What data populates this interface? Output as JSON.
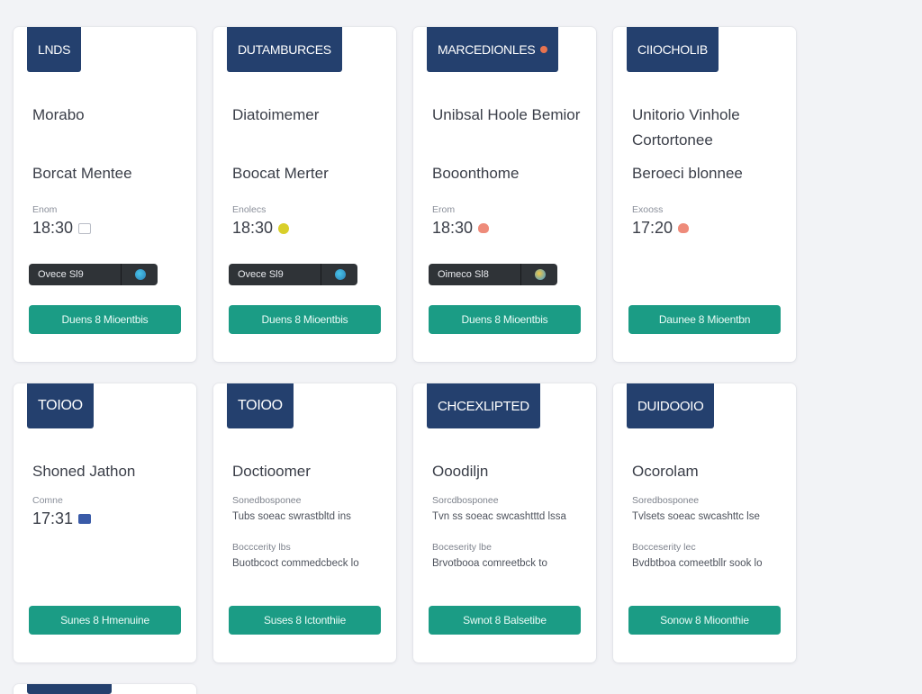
{
  "colors": {
    "tag_bg": "#24406e",
    "button_bg": "#1b9c85",
    "pill_bg": "#2f3337",
    "page_bg": "#f2f3f6"
  },
  "row1": [
    {
      "tag": "LNDS",
      "title": "Morabo",
      "subtitle": "Borcat Mentee",
      "mini": "Enom",
      "time": "18:30",
      "time_icon": "calendar-icon",
      "pill": "Ovece  Sl9",
      "button": "Duens 8  Mioentbis",
      "tag_icon": null
    },
    {
      "tag": "DUTAMBURCES",
      "title": "Diatoimemer",
      "subtitle": "Boocat Merter",
      "mini": "Enolecs",
      "time": "18:30",
      "time_icon": "smiley-icon",
      "pill": "Ovece  Sl9",
      "button": "Duens 8  Mioentbis",
      "tag_icon": null
    },
    {
      "tag": "MARCEDIONLES",
      "title": "Unibsal Hoole Bemior",
      "subtitle": "Booonthome",
      "mini": "Erom",
      "time": "18:30",
      "time_icon": "heart-icon",
      "pill": "Oimeco  Sl8",
      "button": "Duens 8  Mioentbis",
      "tag_icon": "dot-icon"
    },
    {
      "tag": "CIIOCHOLIB",
      "title": "Unitorio Vinhole Cortortonee",
      "subtitle": "Beroeci blonnee",
      "mini": "Exooss",
      "time": "17:20",
      "time_icon": "heart-icon",
      "pill": null,
      "button": "Daunee 8  Mioentbn",
      "tag_icon": null
    }
  ],
  "row2": [
    {
      "tag": "TOIOO",
      "title": "Shoned Jathon",
      "mini": "Comne",
      "time": "17:31",
      "time_icon": "badge-icon",
      "lines": [],
      "button": "Sunes 8  Hmenuine"
    },
    {
      "tag": "TOIOO",
      "title": "Doctioomer",
      "mini": null,
      "time": null,
      "time_icon": null,
      "lines": [
        "Sonedbosponee",
        "Tubs soeac swrastbltd ins",
        "Bocccerity lbs",
        "Buotbcoct commedcbeck lo"
      ],
      "button": "Suses 8  Ictonthiie"
    },
    {
      "tag": "CHCEXLIPTED",
      "title": "Ooodiljn",
      "mini": null,
      "time": null,
      "time_icon": null,
      "lines": [
        "Sorcdbosponee",
        "Tvn ss soeac swcashtttd lssa",
        "Boceserity lbe",
        "Brvotbooa comreetbck to"
      ],
      "button": "Swnot 8  Balsetibe"
    },
    {
      "tag": "DUIDOOIO",
      "title": "Ocorolam",
      "mini": null,
      "time": null,
      "time_icon": null,
      "lines": [
        "Soredbosponee",
        "Tvlsets soeac swcashttc lse",
        "Bocceserity lec",
        "Bvdbtboa comeetbllr sook lo"
      ],
      "button": "Sonow 8  Mioonthie"
    }
  ],
  "row3": [
    {
      "tag": ""
    }
  ]
}
